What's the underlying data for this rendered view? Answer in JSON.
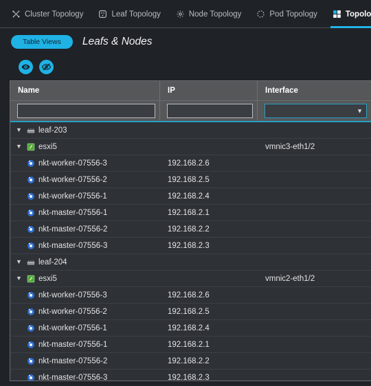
{
  "tabs": [
    {
      "label": "Cluster Topology",
      "icon": "cluster-topology-icon",
      "active": false
    },
    {
      "label": "Leaf Topology",
      "icon": "leaf-topology-icon",
      "active": false
    },
    {
      "label": "Node Topology",
      "icon": "node-topology-icon",
      "active": false
    },
    {
      "label": "Pod Topology",
      "icon": "pod-topology-icon",
      "active": false
    },
    {
      "label": "Topology Table",
      "icon": "topology-table-icon",
      "active": true
    }
  ],
  "toolbar": {
    "table_views_label": "Table Views",
    "view_title": "Leafs & Nodes",
    "show_icon": "eye-icon",
    "hide_icon": "eye-slash-icon"
  },
  "table": {
    "columns": [
      {
        "key": "name",
        "label": "Name"
      },
      {
        "key": "ip",
        "label": "IP"
      },
      {
        "key": "interface",
        "label": "Interface"
      }
    ],
    "filters": {
      "name_value": "",
      "name_placeholder": "",
      "ip_value": "",
      "ip_placeholder": "",
      "interface_value": "",
      "interface_placeholder": ""
    },
    "rows": [
      {
        "level": 1,
        "expanded": true,
        "icon": "switch-icon",
        "name": "leaf-203",
        "ip": "",
        "interface": ""
      },
      {
        "level": 2,
        "expanded": true,
        "icon": "host-icon",
        "name": "esxi5",
        "ip": "",
        "interface": "vmnic3-eth1/2"
      },
      {
        "level": 3,
        "expanded": null,
        "icon": "node-icon",
        "name": "nkt-worker-07556-3",
        "ip": "192.168.2.6",
        "interface": ""
      },
      {
        "level": 3,
        "expanded": null,
        "icon": "node-icon",
        "name": "nkt-worker-07556-2",
        "ip": "192.168.2.5",
        "interface": ""
      },
      {
        "level": 3,
        "expanded": null,
        "icon": "node-icon",
        "name": "nkt-worker-07556-1",
        "ip": "192.168.2.4",
        "interface": ""
      },
      {
        "level": 3,
        "expanded": null,
        "icon": "node-icon",
        "name": "nkt-master-07556-1",
        "ip": "192.168.2.1",
        "interface": ""
      },
      {
        "level": 3,
        "expanded": null,
        "icon": "node-icon",
        "name": "nkt-master-07556-2",
        "ip": "192.168.2.2",
        "interface": ""
      },
      {
        "level": 3,
        "expanded": null,
        "icon": "node-icon",
        "name": "nkt-master-07556-3",
        "ip": "192.168.2.3",
        "interface": ""
      },
      {
        "level": 1,
        "expanded": true,
        "icon": "switch-icon",
        "name": "leaf-204",
        "ip": "",
        "interface": ""
      },
      {
        "level": 2,
        "expanded": true,
        "icon": "host-icon",
        "name": "esxi5",
        "ip": "",
        "interface": "vmnic2-eth1/2"
      },
      {
        "level": 3,
        "expanded": null,
        "icon": "node-icon",
        "name": "nkt-worker-07556-3",
        "ip": "192.168.2.6",
        "interface": ""
      },
      {
        "level": 3,
        "expanded": null,
        "icon": "node-icon",
        "name": "nkt-worker-07556-2",
        "ip": "192.168.2.5",
        "interface": ""
      },
      {
        "level": 3,
        "expanded": null,
        "icon": "node-icon",
        "name": "nkt-worker-07556-1",
        "ip": "192.168.2.4",
        "interface": ""
      },
      {
        "level": 3,
        "expanded": null,
        "icon": "node-icon",
        "name": "nkt-master-07556-1",
        "ip": "192.168.2.1",
        "interface": ""
      },
      {
        "level": 3,
        "expanded": null,
        "icon": "node-icon",
        "name": "nkt-master-07556-2",
        "ip": "192.168.2.2",
        "interface": ""
      },
      {
        "level": 3,
        "expanded": null,
        "icon": "node-icon",
        "name": "nkt-master-07556-3",
        "ip": "192.168.2.3",
        "interface": ""
      }
    ]
  },
  "colors": {
    "accent": "#21b3e8",
    "background": "#1f2227",
    "table_background": "#2e3135",
    "header_background": "#555759",
    "node_icon": "#2f6fd0",
    "host_icon": "#4fa83d",
    "switch_icon": "#8d9198",
    "text": "#e3e4e6"
  }
}
